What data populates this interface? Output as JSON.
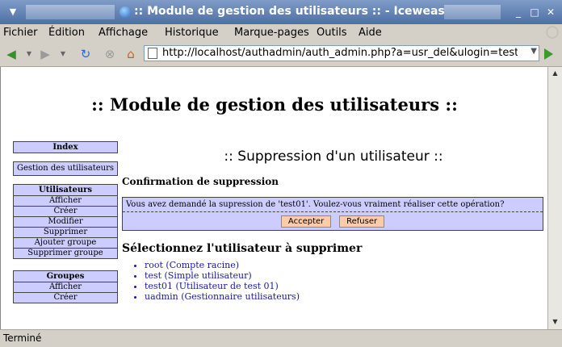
{
  "window": {
    "title": ":: Module de gestion des utilisateurs :: - Iceweasel",
    "controls": [
      "_",
      "□",
      "✕"
    ]
  },
  "menu": [
    "Fichier",
    "Édition",
    "Affichage",
    "Historique",
    "Marque-pages",
    "Outils",
    "Aide"
  ],
  "toolbar": {
    "url": "http://localhost/authadmin/auth_admin.php?a=usr_del&ulogin=test01",
    "icons": [
      "back-icon",
      "forward-icon",
      "reload-icon",
      "stop-icon",
      "home-icon"
    ]
  },
  "page": {
    "title": ":: Module de gestion des utilisateurs ::",
    "subtitle": ":: Suppression d'un utilisateur ::",
    "confirm_heading": "Confirmation de suppression",
    "confirm_message": "Vous avez demandé la supression de 'test01'. Voulez-vous vraiment réaliser cette opération?",
    "accept_label": "Accepter",
    "refuse_label": "Refuser",
    "select_heading": "Sélectionnez l'utilisateur à supprimer",
    "users": [
      "root (Compte racine)",
      "test (Simple utilisateur)",
      "test01 (Utilisateur de test 01)",
      "uadmin (Gestionnaire utilisateurs)"
    ]
  },
  "sidebar": {
    "index": "Index",
    "gestion": "Gestion des utilisateurs",
    "users_group": {
      "head": "Utilisateurs",
      "items": [
        "Afficher",
        "Créer",
        "Modifier",
        "Supprimer",
        "Ajouter groupe",
        "Supprimer groupe"
      ]
    },
    "groups_group": {
      "head": "Groupes",
      "items": [
        "Afficher",
        "Créer"
      ]
    }
  },
  "status": "Terminé"
}
